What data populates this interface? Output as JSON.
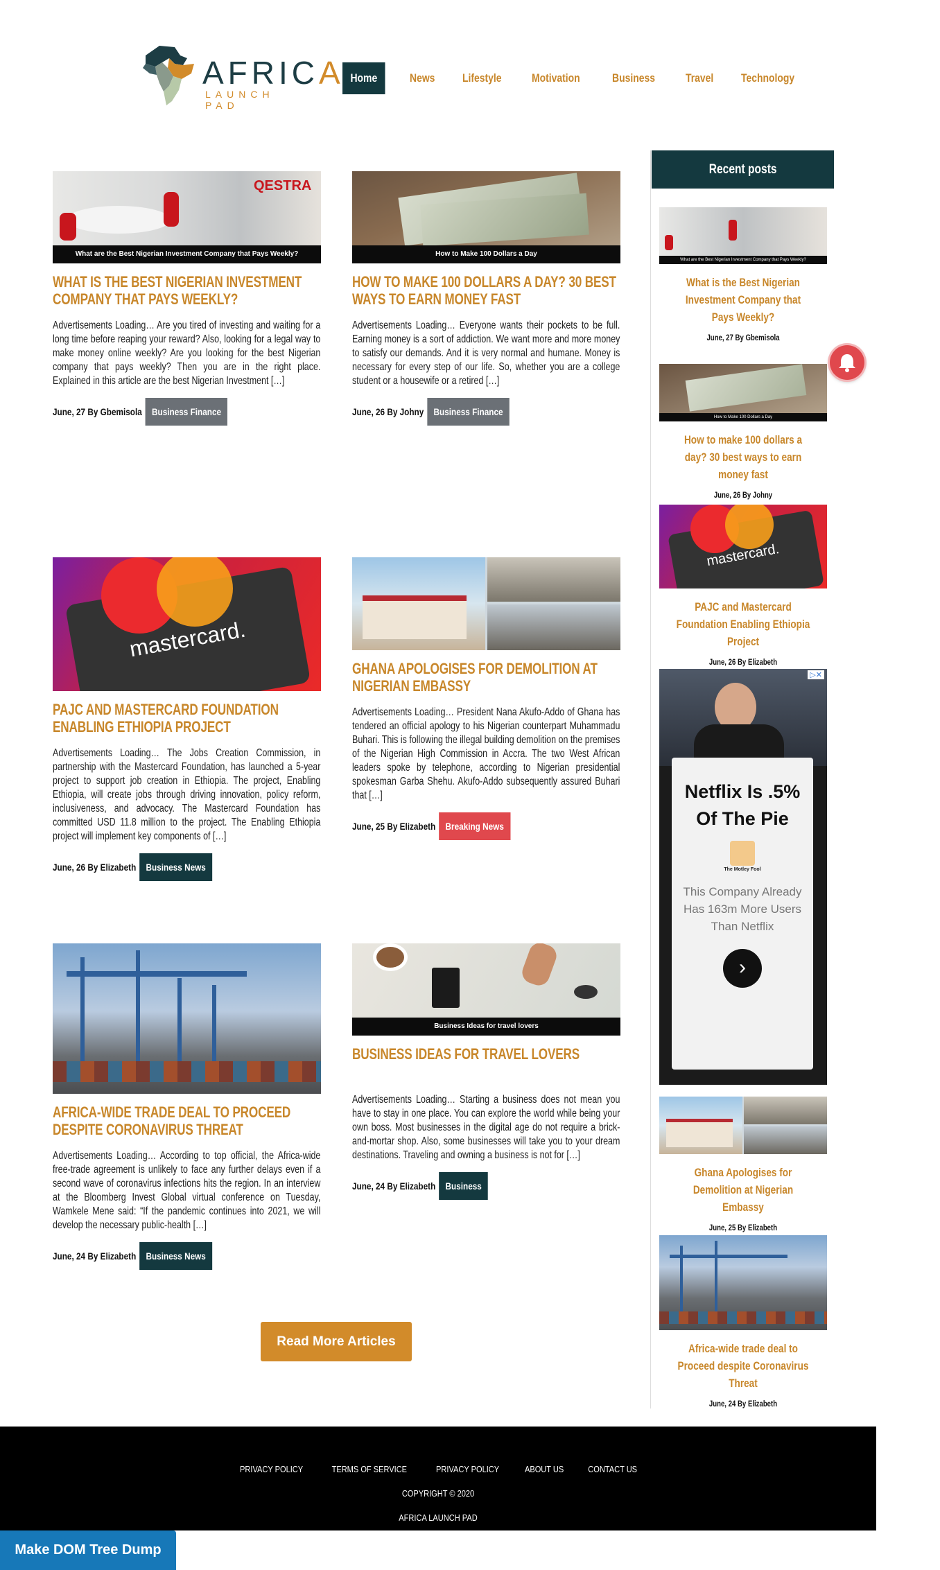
{
  "logo": {
    "word_main": "AFRIC",
    "word_accent": "A",
    "sub": "LAUNCH PAD"
  },
  "nav": [
    "Home",
    "News",
    "Lifestyle",
    "Motivation",
    "Business",
    "Travel",
    "Technology"
  ],
  "articles": [
    {
      "caption": "What are the Best Nigerian Investment Company that Pays Weekly?",
      "title": "What is the Best Nigerian Investment Company that Pays Weekly?",
      "excerpt": "Advertisements Loading… Are you tired of investing and waiting for a long time before reaping your reward? Also, looking for a legal way to make money online weekly? Are you looking for the best Nigerian company that pays weekly? Then you are in the right place. Explained in this article are the best Nigerian Investment […]",
      "date": "June, 27",
      "by": "By Gbemisola",
      "tag": "Business Finance"
    },
    {
      "caption": "How to Make 100 Dollars a Day",
      "title": "How to make 100 dollars a day? 30 best ways to earn money fast",
      "excerpt": "Advertisements Loading… Everyone wants their pockets to be full. Earning money is a sort of addiction. We want more and more money to satisfy our demands. And it is very normal and humane. Money is necessary for every step of our life. So, whether you are a college student or a housewife or a retired […]",
      "date": "June, 26",
      "by": "By Johny",
      "tag": "Business Finance"
    },
    {
      "caption": "",
      "title": "PAJC and Mastercard Foundation Enabling Ethiopia Project",
      "excerpt": "Advertisements Loading… The Jobs Creation Commission, in partnership with the Mastercard Foundation, has launched a 5-year project to support job creation in Ethiopia. The project, Enabling Ethiopia,  will create jobs through driving innovation, policy reform, inclusiveness, and advocacy. The Mastercard Foundation has committed  USD 11.8 million to the project. The Enabling Ethiopia project will implement key components of […]",
      "date": "June, 26",
      "by": "By Elizabeth",
      "tag": "Business News"
    },
    {
      "caption": "",
      "title": "Ghana Apologises for Demolition at Nigerian Embassy",
      "excerpt": "Advertisements Loading… President Nana Akufo-Addo of Ghana has tendered an official apology to his Nigerian counterpart Muhammadu Buhari. This is following the illegal building demolition on the premises of the Nigerian High Commission in Accra. The two West African leaders spoke by telephone, according to Nigerian presidential spokesman Garba Shehu. Akufo-Addo subsequently assured Buhari that […]",
      "date": "June, 25",
      "by": "By Elizabeth",
      "tag": "Breaking News"
    },
    {
      "caption": "",
      "title": "Africa-wide trade deal to Proceed despite Coronavirus Threat",
      "excerpt": "Advertisements Loading… According to top official, the Africa-wide free-trade agreement is unlikely to face any further delays even if a second wave of coronavirus infections hits the region. In an interview at the Bloomberg Invest Global virtual conference on Tuesday, Wamkele Mene said: “If the pandemic continues into 2021, we will develop the necessary public-health […]",
      "date": "June, 24",
      "by": "By Elizabeth",
      "tag": "Business News"
    },
    {
      "caption": "Business Ideas for travel lovers",
      "title": "Business Ideas for travel lovers",
      "excerpt": "Advertisements Loading… Starting a business does not mean you have to stay in one place. You can explore the world while being your own boss. Most businesses in the digital age do not require a brick-and-mortar shop. Also, some businesses will take you to your dream destinations.  Traveling and owning a business is not for […]",
      "date": "June, 24",
      "by": "By Elizabeth",
      "tag": "Business"
    }
  ],
  "sidebar": {
    "heading": "Recent posts",
    "posts": [
      {
        "caption": "What are the Best Nigerian Investment Company that Pays Weekly?",
        "title": "What is the Best Nigerian Investment Company that Pays Weekly?",
        "date": "June, 27",
        "by": "By Gbemisola"
      },
      {
        "caption": "How to Make 100 Dollars a Day",
        "title": "How to make 100 dollars a day? 30 best ways to earn money fast",
        "date": "June, 26",
        "by": "By Johny"
      },
      {
        "caption": "",
        "title": "PAJC and Mastercard Foundation Enabling Ethiopia Project",
        "date": "June, 26",
        "by": "By Elizabeth"
      },
      {
        "caption": "",
        "title": "Ghana Apologises for Demolition at Nigerian Embassy",
        "date": "June, 25",
        "by": "By Elizabeth"
      },
      {
        "caption": "",
        "title": "Africa-wide trade deal to Proceed despite Coronavirus Threat",
        "date": "June, 24",
        "by": "By Elizabeth"
      }
    ],
    "ad": {
      "headline": "Netflix Is .5% Of The Pie",
      "brand": "The Motley Fool",
      "body": "This Company Already Has 163m More Users Than Netflix",
      "arrow": "›",
      "adchoices": "▷✕"
    }
  },
  "read_more": "Read More Articles",
  "footer": {
    "links": [
      "PRIVACY POLICY",
      "TERMS OF SERVICE",
      "PRIVACY POLICY",
      "ABOUT US",
      "CONTACT US"
    ],
    "copyright": "COPYRIGHT © 2020",
    "name": "AFRICA LAUNCH PAD"
  },
  "dom_button": "Make DOM Tree Dump",
  "colors": {
    "accent": "#d28b2a",
    "dark": "#14393f",
    "red": "#e0484d",
    "grey": "#6b7076"
  }
}
